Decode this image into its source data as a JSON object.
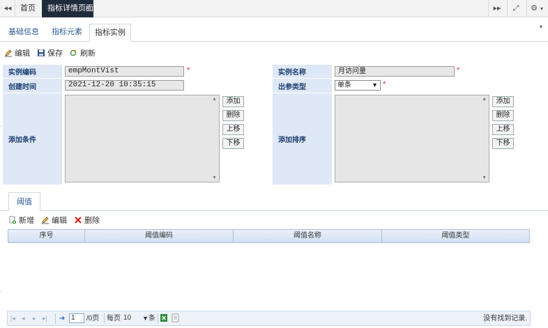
{
  "topbar": {
    "left_arrow": "◂◂",
    "home_tab": "首页",
    "active_tab": "指标详情页面",
    "active_tab_close": "×",
    "right_arrow": "▸▸",
    "expand_icon": "⤢",
    "settings_icon": "⚙",
    "dropdown_icon": "▾"
  },
  "subtabs": [
    "基础信息",
    "指标元素",
    "指标实例"
  ],
  "toolbar": {
    "edit": "编辑",
    "save": "保存",
    "refresh": "刷新"
  },
  "form": {
    "instance_code_label": "实例编码",
    "instance_code_value": "empMontVist",
    "instance_name_label": "实例名称",
    "instance_name_value": "月访问量",
    "create_time_label": "创建时间",
    "create_time_value": "2021-12-20 10:35:15",
    "output_type_label": "出参类型",
    "output_type_value": "单条",
    "add_condition_label": "添加条件",
    "add_sort_label": "添加排序",
    "required_mark": "*",
    "buttons": {
      "add": "添加",
      "delete": "删除",
      "up": "上移",
      "down": "下移"
    }
  },
  "threshold": {
    "tab": "阈值",
    "toolbar": {
      "add": "新增",
      "edit": "编辑",
      "delete": "删除"
    },
    "columns": [
      "序号",
      "阈值编码",
      "阈值名称",
      "阈值类型"
    ]
  },
  "pager": {
    "first": "|◂",
    "prev": "◂",
    "next": "▸",
    "last": "▸|",
    "go_icon": "➔",
    "page_value": "1",
    "page_total": "/0页",
    "per_page_prefix": "每页",
    "per_page_value": "10",
    "per_page_suffix": "条",
    "status": "没有找到记录."
  },
  "colors": {
    "accent": "#1f2a3a",
    "label_bg": "#dfe8f6",
    "label_text": "#1c3f73",
    "required": "#e02020",
    "grid_border": "#a9bfdc"
  }
}
